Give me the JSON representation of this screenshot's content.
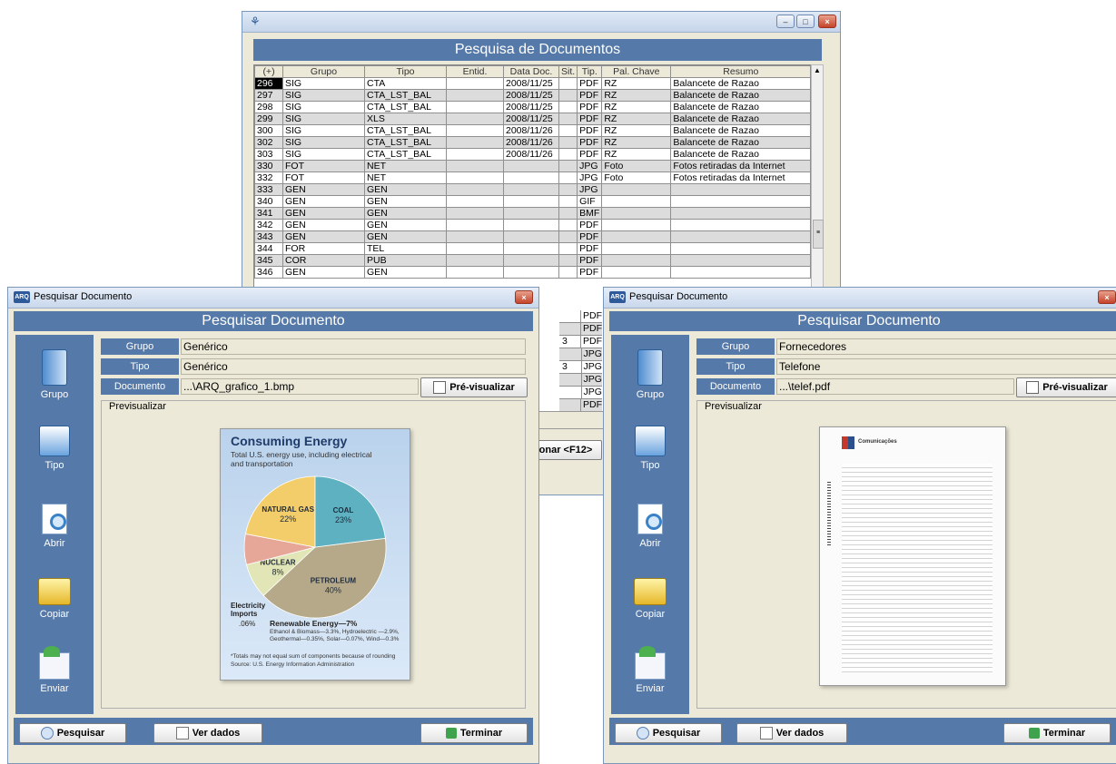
{
  "grid_window": {
    "title": "Pesquisa de Documentos",
    "columns": [
      "(+)",
      "Grupo",
      "Tipo",
      "Entid.",
      "Data Doc.",
      "Sit.",
      "Tip.",
      "Pal. Chave",
      "Resumo"
    ],
    "rows": [
      [
        "296",
        "SIG",
        "CTA",
        "",
        "2008/11/25",
        "",
        "PDF",
        "RZ",
        "Balancete de Razao"
      ],
      [
        "297",
        "SIG",
        "CTA_LST_BAL",
        "",
        "2008/11/25",
        "",
        "PDF",
        "RZ",
        "Balancete de Razao"
      ],
      [
        "298",
        "SIG",
        "CTA_LST_BAL",
        "",
        "2008/11/25",
        "",
        "PDF",
        "RZ",
        "Balancete de Razao"
      ],
      [
        "299",
        "SIG",
        "XLS",
        "",
        "2008/11/25",
        "",
        "PDF",
        "RZ",
        "Balancete de Razao"
      ],
      [
        "300",
        "SIG",
        "CTA_LST_BAL",
        "",
        "2008/11/26",
        "",
        "PDF",
        "RZ",
        "Balancete de Razao"
      ],
      [
        "302",
        "SIG",
        "CTA_LST_BAL",
        "",
        "2008/11/26",
        "",
        "PDF",
        "RZ",
        "Balancete de Razao"
      ],
      [
        "303",
        "SIG",
        "CTA_LST_BAL",
        "",
        "2008/11/26",
        "",
        "PDF",
        "RZ",
        "Balancete de Razao"
      ],
      [
        "330",
        "FOT",
        "NET",
        "",
        "",
        "",
        "JPG",
        "Foto",
        "Fotos retiradas da Internet"
      ],
      [
        "332",
        "FOT",
        "NET",
        "",
        "",
        "",
        "JPG",
        "Foto",
        "Fotos retiradas da Internet"
      ],
      [
        "333",
        "GEN",
        "GEN",
        "",
        "",
        "",
        "JPG",
        "",
        ""
      ],
      [
        "340",
        "GEN",
        "GEN",
        "",
        "",
        "",
        "GIF",
        "",
        ""
      ],
      [
        "341",
        "GEN",
        "GEN",
        "",
        "",
        "",
        "BMF",
        "",
        ""
      ],
      [
        "342",
        "GEN",
        "GEN",
        "",
        "",
        "",
        "PDF",
        "",
        ""
      ],
      [
        "343",
        "GEN",
        "GEN",
        "",
        "",
        "",
        "PDF",
        "",
        ""
      ],
      [
        "344",
        "FOR",
        "TEL",
        "",
        "",
        "",
        "PDF",
        "",
        ""
      ],
      [
        "345",
        "COR",
        "PUB",
        "",
        "",
        "",
        "PDF",
        "",
        ""
      ],
      [
        "346",
        "GEN",
        "GEN",
        "",
        "",
        "",
        "PDF",
        "",
        ""
      ]
    ],
    "hidden_tail_sit": [
      "",
      "",
      "3",
      "",
      "3",
      "",
      "",
      ""
    ],
    "hidden_tail_tip": [
      "PDF",
      "PDF",
      "PDF",
      "JPG",
      "JPG",
      "JPG",
      "JPG",
      "PDF"
    ],
    "partial_button_label": "onar <F12>"
  },
  "dialog_left": {
    "window_title": "Pesquisar Documento",
    "header": "Pesquisar Documento",
    "fields": {
      "grupo_label": "Grupo",
      "grupo_value": "Genérico",
      "tipo_label": "Tipo",
      "tipo_value": "Genérico",
      "documento_label": "Documento",
      "documento_value": "...\\ARQ_grafico_1.bmp"
    },
    "preview_button": "Pré-visualizar",
    "preview_label": "Previsualizar",
    "buttons": {
      "pesquisar": "Pesquisar",
      "ver_dados": "Ver dados",
      "terminar": "Terminar"
    },
    "preview_image": {
      "title": "Consuming Energy",
      "subtitle_line1": "Total U.S. energy use, including electrical",
      "subtitle_line2": "and transportation",
      "footnote_line1": "*Totals may not equal sum of components because of rounding",
      "footnote_line2": "Source: U.S. Energy Information Administration",
      "electricity_label_1": "Electricity",
      "electricity_label_2": "Imports",
      "electricity_value": ".06%",
      "renewable_label": "Renewable Energy—7%",
      "renewable_detail_1": "Ethanol & Biomass—3.3%, Hydroelectric —2.9%,",
      "renewable_detail_2": "Geothermal—0.35%, Solar—0.07%, Wind—0.3%",
      "chart_data": {
        "type": "pie",
        "slices": [
          {
            "label": "PETROLEUM",
            "value": 40,
            "display": "40%",
            "color": "#b6a98a"
          },
          {
            "label": "NUCLEAR",
            "value": 8,
            "display": "8%",
            "color": "#e2e5b5"
          },
          {
            "label": "Renewable Energy",
            "value": 7,
            "display": "",
            "color": "#e6a798"
          },
          {
            "label": "NATURAL GAS",
            "value": 22,
            "display": "22%",
            "color": "#f2cd6a"
          },
          {
            "label": "COAL",
            "value": 23,
            "display": "23%",
            "color": "#5eb1c1"
          }
        ]
      }
    }
  },
  "dialog_right": {
    "window_title": "Pesquisar Documento",
    "header": "Pesquisar Documento",
    "fields": {
      "grupo_label": "Grupo",
      "grupo_value": "Fornecedores",
      "tipo_label": "Tipo",
      "tipo_value": "Telefone",
      "documento_label": "Documento",
      "documento_value": "...\\telef.pdf"
    },
    "preview_button": "Pré-visualizar",
    "preview_label": "Previsualizar",
    "buttons": {
      "pesquisar": "Pesquisar",
      "ver_dados": "Ver dados",
      "terminar": "Terminar"
    },
    "preview_doc": {
      "company": "Comunicações"
    }
  },
  "sidebar": {
    "items": [
      "Grupo",
      "Tipo",
      "Abrir",
      "Copiar",
      "Enviar"
    ]
  },
  "app_icon_text": "ARQ",
  "colors": {
    "accent": "#5579a8",
    "window_bg": "#ece9d8"
  }
}
